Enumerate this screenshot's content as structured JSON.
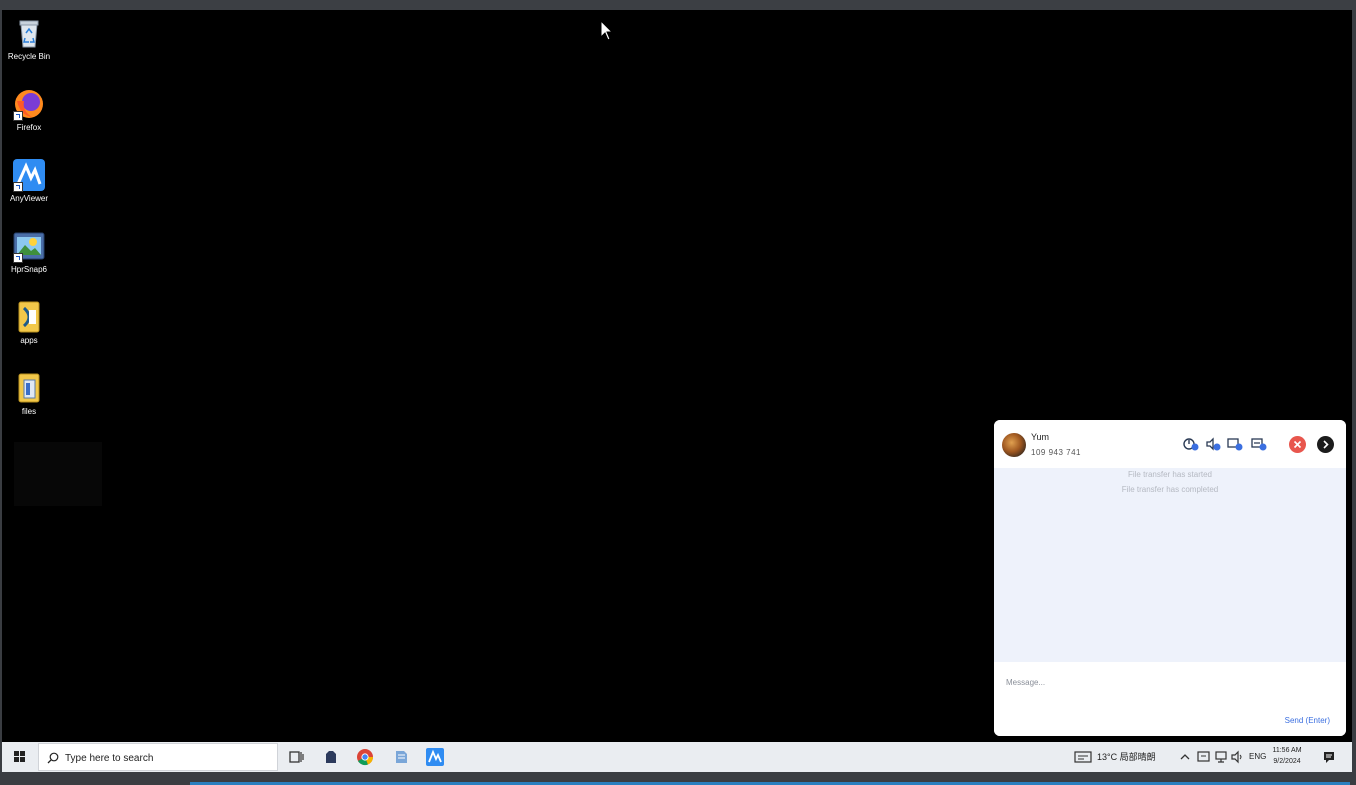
{
  "desktop": {
    "icons": [
      {
        "label": "Recycle Bin",
        "icon": "recycle-bin-icon"
      },
      {
        "label": "Firefox",
        "icon": "firefox-icon"
      },
      {
        "label": "AnyViewer",
        "icon": "anyviewer-icon"
      },
      {
        "label": "HprSnap6",
        "icon": "hypersnap-icon"
      },
      {
        "label": "apps",
        "icon": "apps-folder-icon"
      },
      {
        "label": "files",
        "icon": "files-folder-icon"
      }
    ]
  },
  "chat": {
    "peer_name": "Yum",
    "peer_id": "109 943 741",
    "messages": [
      "File transfer has started",
      "File transfer has completed"
    ],
    "input_placeholder": "Message...",
    "send_label": "Send (Enter)",
    "toolbar_icons": [
      "remote-control-icon",
      "sound-icon",
      "screen-monitor-icon",
      "file-transfer-icon"
    ],
    "colors": {
      "accent": "#3b6fe0",
      "close": "#e8564d",
      "body_bg": "#eef2fb"
    }
  },
  "taskbar": {
    "search_placeholder": "Type here to search",
    "apps": [
      "task-view-icon",
      "app-icon",
      "chrome-icon",
      "file-icon",
      "anyviewer-icon"
    ],
    "weather": "13°C 局部晴朗",
    "language": "ENG",
    "time": "11:56 AM",
    "date": "9/2/2024"
  }
}
